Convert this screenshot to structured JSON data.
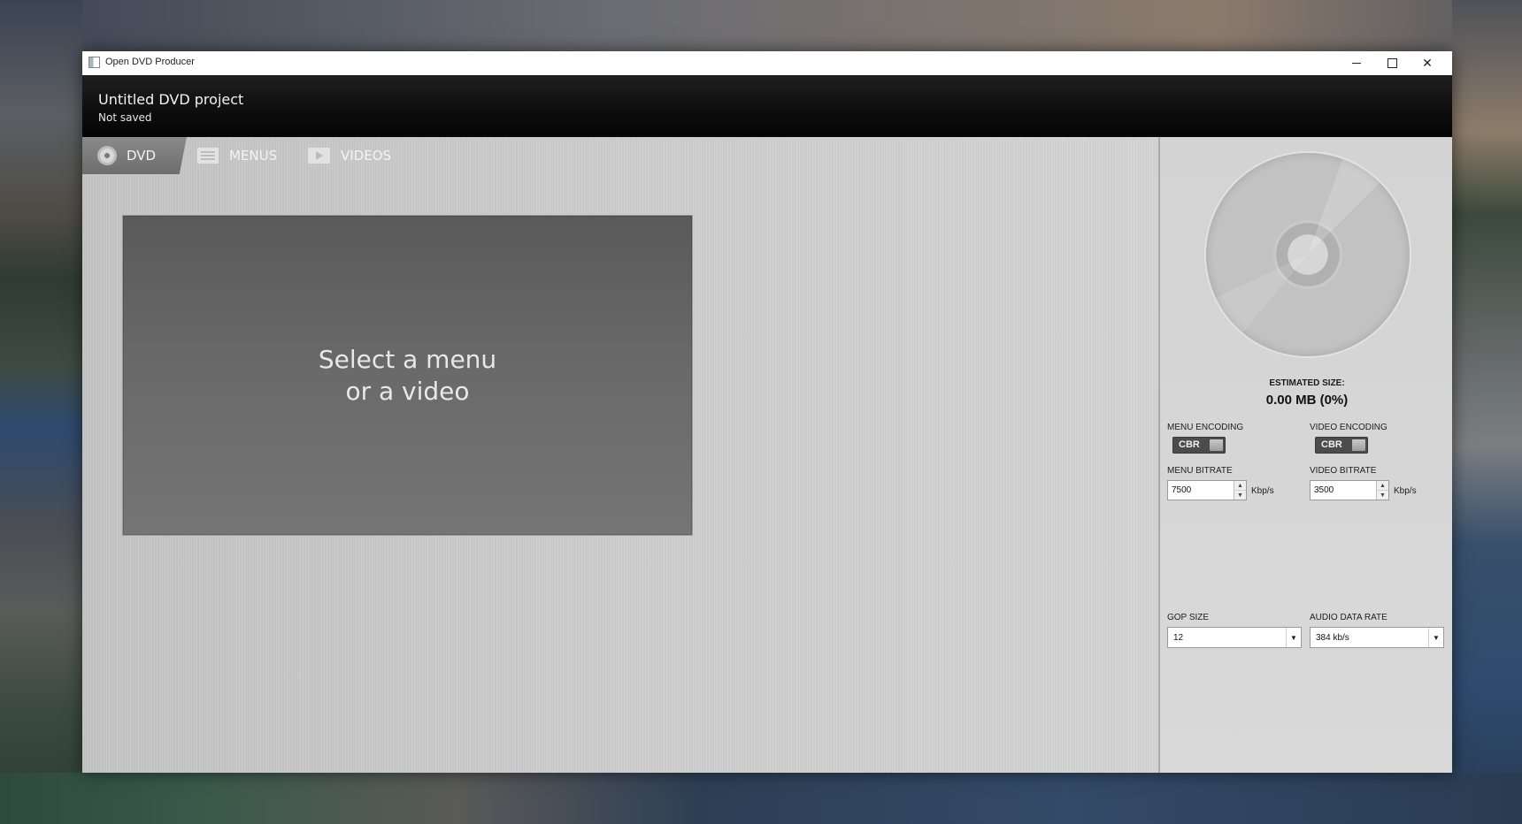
{
  "window": {
    "title": "Open DVD Producer"
  },
  "header": {
    "project_title": "Untitled DVD project",
    "project_status": "Not saved"
  },
  "tabs": [
    {
      "label": "DVD",
      "icon": "disc-icon",
      "active": true
    },
    {
      "label": "MENUS",
      "icon": "menu-list-icon",
      "active": false
    },
    {
      "label": "VIDEOS",
      "icon": "video-play-icon",
      "active": false
    }
  ],
  "preview": {
    "placeholder_line1": "Select a menu",
    "placeholder_line2": "or a video"
  },
  "sidebar": {
    "estimated_size_label": "ESTIMATED SIZE:",
    "estimated_size_value": "0.00 MB (0%)",
    "menu_encoding": {
      "label": "MENU ENCODING",
      "value": "CBR"
    },
    "video_encoding": {
      "label": "VIDEO ENCODING",
      "value": "CBR"
    },
    "menu_bitrate": {
      "label": "MENU BITRATE",
      "value": "7500",
      "unit": "Kbp/s"
    },
    "video_bitrate": {
      "label": "VIDEO BITRATE",
      "value": "3500",
      "unit": "Kbp/s"
    },
    "gop_size": {
      "label": "GOP SIZE",
      "value": "12"
    },
    "audio_data_rate": {
      "label": "AUDIO DATA RATE",
      "value": "384 kb/s"
    }
  },
  "colors": {
    "header_bg": "#0d0d0d",
    "active_tab": "#7a7a7a",
    "toggle_bg": "#4c4c4c"
  }
}
